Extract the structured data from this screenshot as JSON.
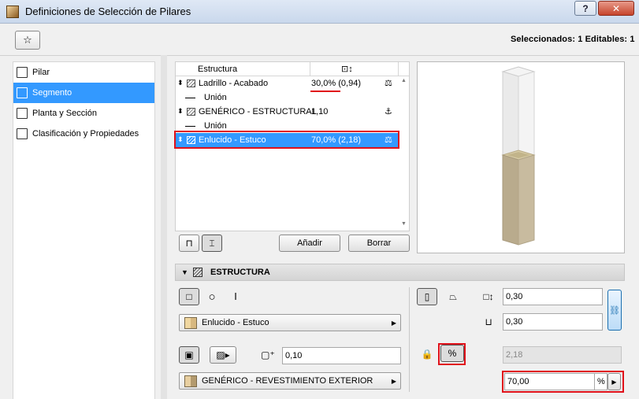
{
  "window": {
    "title": "Definiciones de Selección de Pilares",
    "help_label": "?",
    "close_label": "✕"
  },
  "toolbar": {
    "favorites_icon": "favorites-star-icon",
    "selection_info": "Seleccionados: 1 Editables: 1"
  },
  "sidebar": {
    "items": [
      {
        "label": "Pilar",
        "icon": "column-icon",
        "selected": false
      },
      {
        "label": "Segmento",
        "icon": "segment-icon",
        "selected": true
      },
      {
        "label": "Planta y Sección",
        "icon": "floorplan-section-icon",
        "selected": false
      },
      {
        "label": "Clasificación y Propiedades",
        "icon": "classification-icon",
        "selected": false
      }
    ]
  },
  "structure_table": {
    "header_name": "Estructura",
    "header_thickness_icon": "⊡↕",
    "rows": [
      {
        "type": "skin",
        "name": "Ladrillo - Acabado",
        "value": "30,0% (0,94)",
        "icon": "⚖"
      },
      {
        "type": "join",
        "name": "Unión"
      },
      {
        "type": "skin",
        "name": "GENÉRICO - ESTRUCTURAL",
        "value": "1,10",
        "icon": "⚓"
      },
      {
        "type": "join",
        "name": "Unión"
      },
      {
        "type": "skin",
        "name": "Enlucido - Estuco",
        "value": "70,0% (2,18)",
        "icon": "⚖",
        "selected": true
      }
    ],
    "add_label": "Añadir",
    "delete_label": "Borrar"
  },
  "section": {
    "title": "ESTRUCTURA",
    "collapse_icon": "▼"
  },
  "structure_panel": {
    "material_dropdown": "Enlucido - Estuco",
    "core_thickness": "0,10",
    "building_material": "GENÉRICO - REVESTIMIENTO EXTERIOR",
    "width": "0,30",
    "depth": "0,30",
    "thickness_value": "2,18",
    "percent_value": "70,00",
    "percent_unit": "%",
    "lock_icon": "lock-icon",
    "percent_icon": "%"
  },
  "colors": {
    "selection_blue": "#3399ff",
    "highlight_red": "#e0111a",
    "stucco_tan": "#b9ab8d",
    "brick_light": "#f0f0f0"
  }
}
